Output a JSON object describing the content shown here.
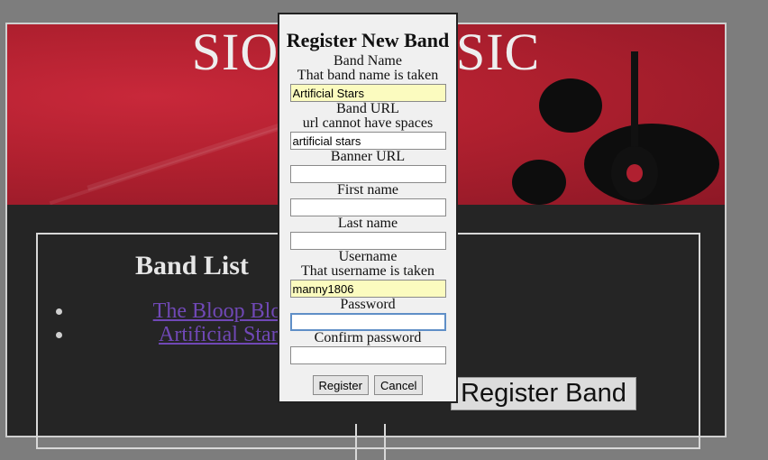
{
  "banner": {
    "title": "SIOUX MUSIC"
  },
  "band_list": {
    "title": "Band List",
    "bands": [
      "The Bloop Blop",
      "Artificial Stars"
    ]
  },
  "register_band_button": "Register Band",
  "modal": {
    "title": "Register New Band",
    "fields": {
      "band_name": {
        "label": "Band Name",
        "error": "That band name is taken",
        "value": "Artificial Stars"
      },
      "band_url": {
        "label": "Band URL",
        "error": "url cannot have spaces",
        "value": "artificial stars"
      },
      "banner_url": {
        "label": "Banner URL",
        "value": ""
      },
      "first_name": {
        "label": "First name",
        "value": ""
      },
      "last_name": {
        "label": "Last name",
        "value": ""
      },
      "username": {
        "label": "Username",
        "error": "That username is taken",
        "value": "manny1806"
      },
      "password": {
        "label": "Password",
        "value": ""
      },
      "confirm_password": {
        "label": "Confirm password",
        "value": ""
      }
    },
    "register_label": "Register",
    "cancel_label": "Cancel"
  }
}
